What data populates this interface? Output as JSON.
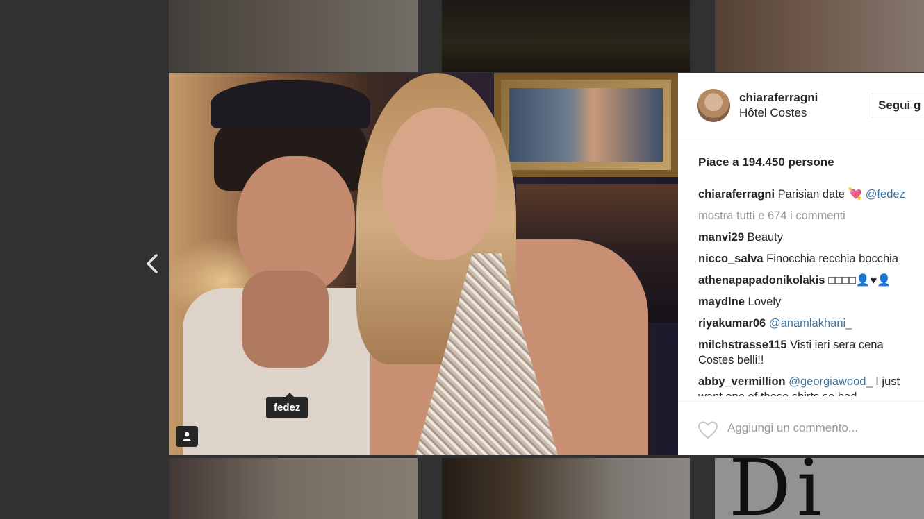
{
  "post": {
    "username": "chiaraferragni",
    "location": "Hôtel Costes",
    "follow_label": "Segui g",
    "likes": "Piace a 194.450 persone",
    "tag_label": "fedez",
    "add_comment_placeholder": "Aggiungi un commento..."
  },
  "caption": {
    "username": "chiaraferragni",
    "text": "Parisian date 💘",
    "mention": "@fedez"
  },
  "show_all": "mostra tutti e 674 i commenti",
  "comments": [
    {
      "user": "manvi29",
      "text": "Beauty",
      "mention": ""
    },
    {
      "user": "nicco_salva",
      "text": "Finocchia recchia bocchia",
      "mention": ""
    },
    {
      "user": "athenapapadonikolakis",
      "text": "□□□□👤♥👤",
      "mention": ""
    },
    {
      "user": "maydlne",
      "text": "Lovely",
      "mention": ""
    },
    {
      "user": "riyakumar06",
      "text": "",
      "mention": "@anamlakhani_"
    },
    {
      "user": "milchstrasse115",
      "text": "Visti ieri sera cena Costes belli!!",
      "mention": ""
    },
    {
      "user": "abby_vermillion",
      "text": "I just want one of these shirts so bad",
      "mention": "@georgiawood_"
    }
  ],
  "background_text": {
    "dior_partial": "Di"
  },
  "icons": {
    "prev": "chevron-left-icon",
    "tag": "user-tag-icon",
    "like": "heart-icon"
  },
  "colors": {
    "link": "#3f729b",
    "text": "#262626",
    "muted": "#999999"
  }
}
